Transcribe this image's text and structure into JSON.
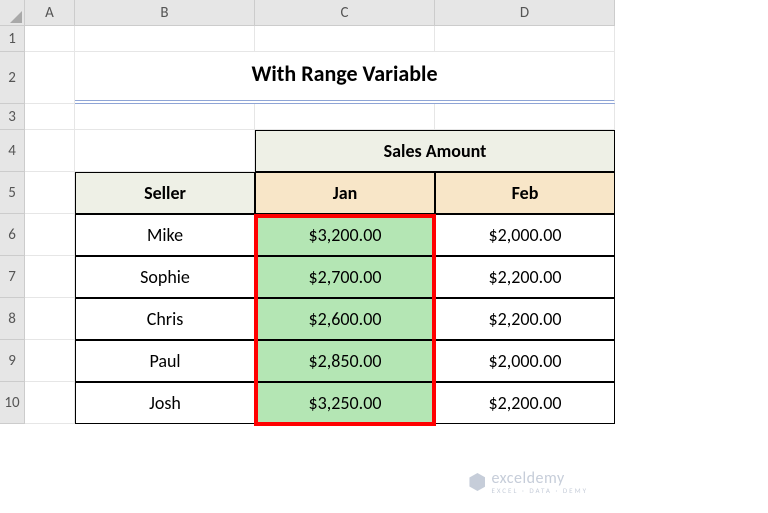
{
  "cols": [
    "A",
    "B",
    "C",
    "D"
  ],
  "rows": [
    "1",
    "2",
    "3",
    "4",
    "5",
    "6",
    "7",
    "8",
    "9",
    "10"
  ],
  "title": "With Range Variable",
  "sales_header": "Sales Amount",
  "seller_header": "Seller",
  "month_jan": "Jan",
  "month_feb": "Feb",
  "sellers": [
    "Mike",
    "Sophie",
    "Chris",
    "Paul",
    "Josh"
  ],
  "jan_values": [
    "$3,200.00",
    "$2,700.00",
    "$2,600.00",
    "$2,850.00",
    "$3,250.00"
  ],
  "feb_values": [
    "$2,000.00",
    "$2,200.00",
    "$2,200.00",
    "$2,000.00",
    "$2,200.00"
  ],
  "watermark_brand": "exceldemy",
  "watermark_sub": "EXCEL · DATA · DEMY"
}
